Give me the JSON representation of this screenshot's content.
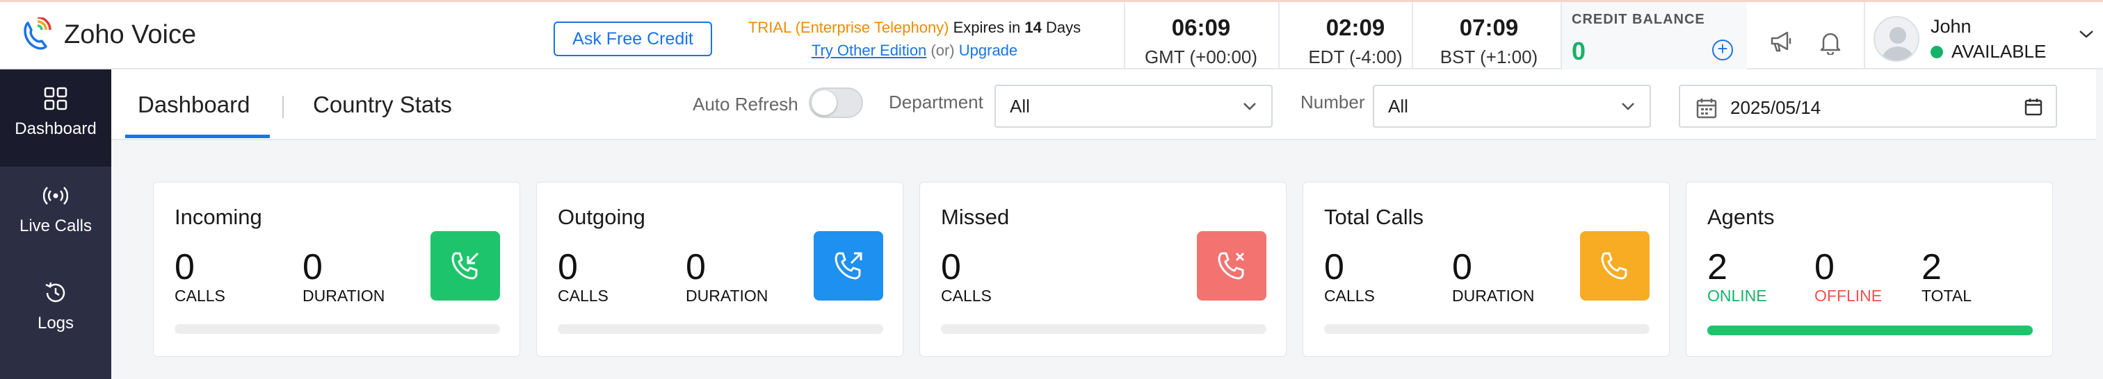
{
  "app": {
    "name": "Zoho Voice"
  },
  "header": {
    "ask_credit": "Ask Free Credit",
    "trial": {
      "plan": "TRIAL (Enterprise Telephony)",
      "expires_prefix": "Expires in",
      "days": "14",
      "days_suffix": "Days",
      "try_other": "Try Other Edition",
      "or": "(or)",
      "upgrade": "Upgrade"
    },
    "clocks": [
      {
        "time": "06:09",
        "zone": "GMT (+00:00)"
      },
      {
        "time": "02:09",
        "zone": "EDT (-4:00)"
      },
      {
        "time": "07:09",
        "zone": "BST (+1:00)"
      }
    ],
    "credit": {
      "label": "CREDIT BALANCE",
      "amount": "0"
    },
    "user": {
      "name": "John",
      "status": "AVAILABLE"
    }
  },
  "sidebar": {
    "items": [
      {
        "label": "Dashboard",
        "icon": "grid-icon",
        "active": true
      },
      {
        "label": "Live Calls",
        "icon": "broadcast-icon",
        "active": false
      },
      {
        "label": "Logs",
        "icon": "history-icon",
        "active": false
      }
    ]
  },
  "tabs": [
    {
      "label": "Dashboard",
      "active": true
    },
    {
      "label": "Country Stats",
      "active": false
    }
  ],
  "filters": {
    "auto_refresh_label": "Auto Refresh",
    "auto_refresh_on": false,
    "department_label": "Department",
    "department_value": "All",
    "number_label": "Number",
    "number_value": "All",
    "date_value": "2025/05/14"
  },
  "cards": [
    {
      "title": "Incoming",
      "stats": [
        {
          "value": "0",
          "label": "CALLS"
        },
        {
          "value": "0",
          "label": "DURATION"
        }
      ],
      "icon": "incoming-call-icon",
      "color": "#1ec46b",
      "progress": 0
    },
    {
      "title": "Outgoing",
      "stats": [
        {
          "value": "0",
          "label": "CALLS"
        },
        {
          "value": "0",
          "label": "DURATION"
        }
      ],
      "icon": "outgoing-call-icon",
      "color": "#1e90f0",
      "progress": 0
    },
    {
      "title": "Missed",
      "stats": [
        {
          "value": "0",
          "label": "CALLS"
        }
      ],
      "icon": "missed-call-icon",
      "color": "#f27370",
      "progress": 0
    },
    {
      "title": "Total Calls",
      "stats": [
        {
          "value": "0",
          "label": "CALLS"
        },
        {
          "value": "0",
          "label": "DURATION"
        }
      ],
      "icon": "phone-icon",
      "color": "#f8ac24",
      "progress": 0
    },
    {
      "title": "Agents",
      "stats": [
        {
          "value": "2",
          "label": "ONLINE",
          "color": "#17b26a"
        },
        {
          "value": "0",
          "label": "OFFLINE",
          "color": "#f0524d"
        },
        {
          "value": "2",
          "label": "TOTAL"
        }
      ],
      "progress": 1
    }
  ]
}
